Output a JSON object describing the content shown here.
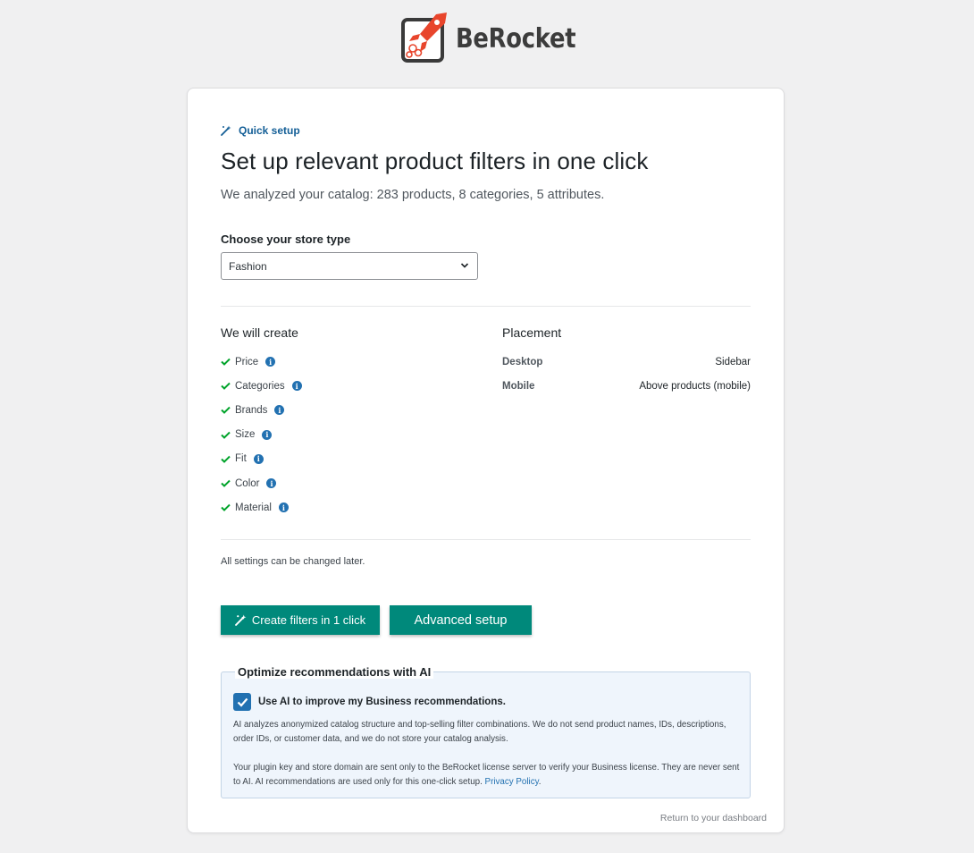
{
  "brand": {
    "name": "BeRocket"
  },
  "eyebrow": "Quick setup",
  "title": "Set up relevant product filters in one click",
  "subtitle": "We analyzed your catalog: 283 products, 8 categories, 5 attributes.",
  "store_type": {
    "label": "Choose your store type",
    "value": "Fashion"
  },
  "create": {
    "heading": "We will create",
    "items": [
      "Price",
      "Categories",
      "Brands",
      "Size",
      "Fit",
      "Color",
      "Material"
    ]
  },
  "placement": {
    "heading": "Placement",
    "rows": [
      {
        "key": "Desktop",
        "value": "Sidebar"
      },
      {
        "key": "Mobile",
        "value": "Above products (mobile)"
      }
    ]
  },
  "note": "All settings can be changed later.",
  "buttons": {
    "primary": "Create filters in 1 click",
    "secondary": "Advanced setup"
  },
  "ai": {
    "legend": "Optimize recommendations with AI",
    "checkbox_label": "Use AI to improve my Business recommendations.",
    "checked": true,
    "p1": "AI analyzes anonymized catalog structure and top-selling filter combinations. We do not send product names, IDs, descriptions, order IDs, or customer data, and we do not store your catalog analysis.",
    "p2": "Your plugin key and store domain are sent only to the BeRocket license server to verify your Business license. They are never sent to AI. AI recommendations are used only for this one-click setup.",
    "privacy_link": "Privacy Policy"
  },
  "return_link": "Return to your dashboard",
  "colors": {
    "accent": "#00897b",
    "link": "#2271b1",
    "check": "#00a32a"
  }
}
